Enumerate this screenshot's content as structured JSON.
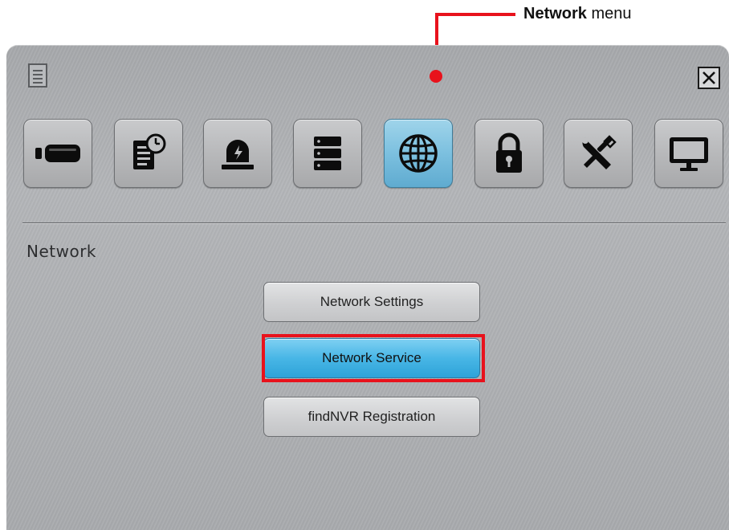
{
  "annotation": {
    "label_bold": "Network",
    "label_rest": " menu",
    "accent_color": "#e8121c"
  },
  "window": {
    "menu_icon": "document-list-icon",
    "close_icon": "close-x-icon"
  },
  "toolbar": {
    "active_index": 4,
    "items": [
      {
        "name": "camera",
        "icon": "camera-icon"
      },
      {
        "name": "record-schedule",
        "icon": "document-clock-icon"
      },
      {
        "name": "event-alarm",
        "icon": "alarm-light-icon"
      },
      {
        "name": "storage",
        "icon": "server-stack-icon"
      },
      {
        "name": "network",
        "icon": "globe-icon"
      },
      {
        "name": "security",
        "icon": "padlock-icon"
      },
      {
        "name": "system-tools",
        "icon": "wrench-screwdriver-icon"
      },
      {
        "name": "display",
        "icon": "monitor-icon"
      }
    ]
  },
  "section": {
    "title": "Network"
  },
  "menu": {
    "items": [
      {
        "label": "Network Settings",
        "selected": false
      },
      {
        "label": "Network Service",
        "selected": true
      },
      {
        "label": "findNVR Registration",
        "selected": false
      }
    ]
  },
  "colors": {
    "active_blue": "#48b6e6",
    "panel_gray": "#b3b5b8"
  }
}
